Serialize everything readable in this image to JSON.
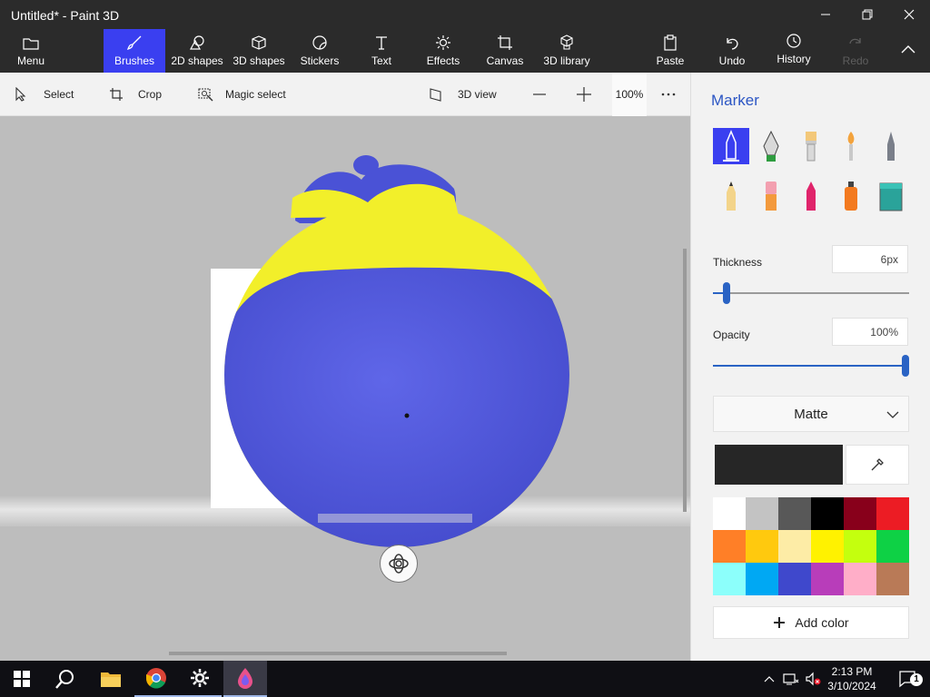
{
  "window": {
    "title": "Untitled* - Paint 3D"
  },
  "ribbon": {
    "menu": "Menu",
    "brushes": "Brushes",
    "shapes2d": "2D shapes",
    "shapes3d": "3D shapes",
    "stickers": "Stickers",
    "text": "Text",
    "effects": "Effects",
    "canvas": "Canvas",
    "library3d": "3D library",
    "paste": "Paste",
    "undo": "Undo",
    "history": "History",
    "redo": "Redo"
  },
  "cmdbar": {
    "select": "Select",
    "crop": "Crop",
    "magic": "Magic select",
    "view3d": "3D view",
    "zoom": "100%"
  },
  "panel": {
    "title": "Marker",
    "thickness_label": "Thickness",
    "thickness_value": "6px",
    "thickness_fraction": 0.07,
    "opacity_label": "Opacity",
    "opacity_value": "100%",
    "opacity_fraction": 1.0,
    "finish": "Matte",
    "current_color": "#262626",
    "add_color": "Add color",
    "palette": [
      "#ffffff",
      "#c3c3c3",
      "#585858",
      "#000000",
      "#88001b",
      "#ec1c24",
      "#ff7f27",
      "#ffc90e",
      "#fdeca6",
      "#fff200",
      "#c4ff0e",
      "#0ed145",
      "#8cfffb",
      "#00a8f3",
      "#3f48cc",
      "#b83dba",
      "#ffaec8",
      "#b97a57"
    ]
  },
  "colors": {
    "accent": "#3a3ff0",
    "ball_blue": "#4a52d6",
    "ball_yellow": "#f2ef2a"
  },
  "taskbar": {
    "time": "2:13 PM",
    "date": "3/10/2024",
    "notifications": "1"
  }
}
